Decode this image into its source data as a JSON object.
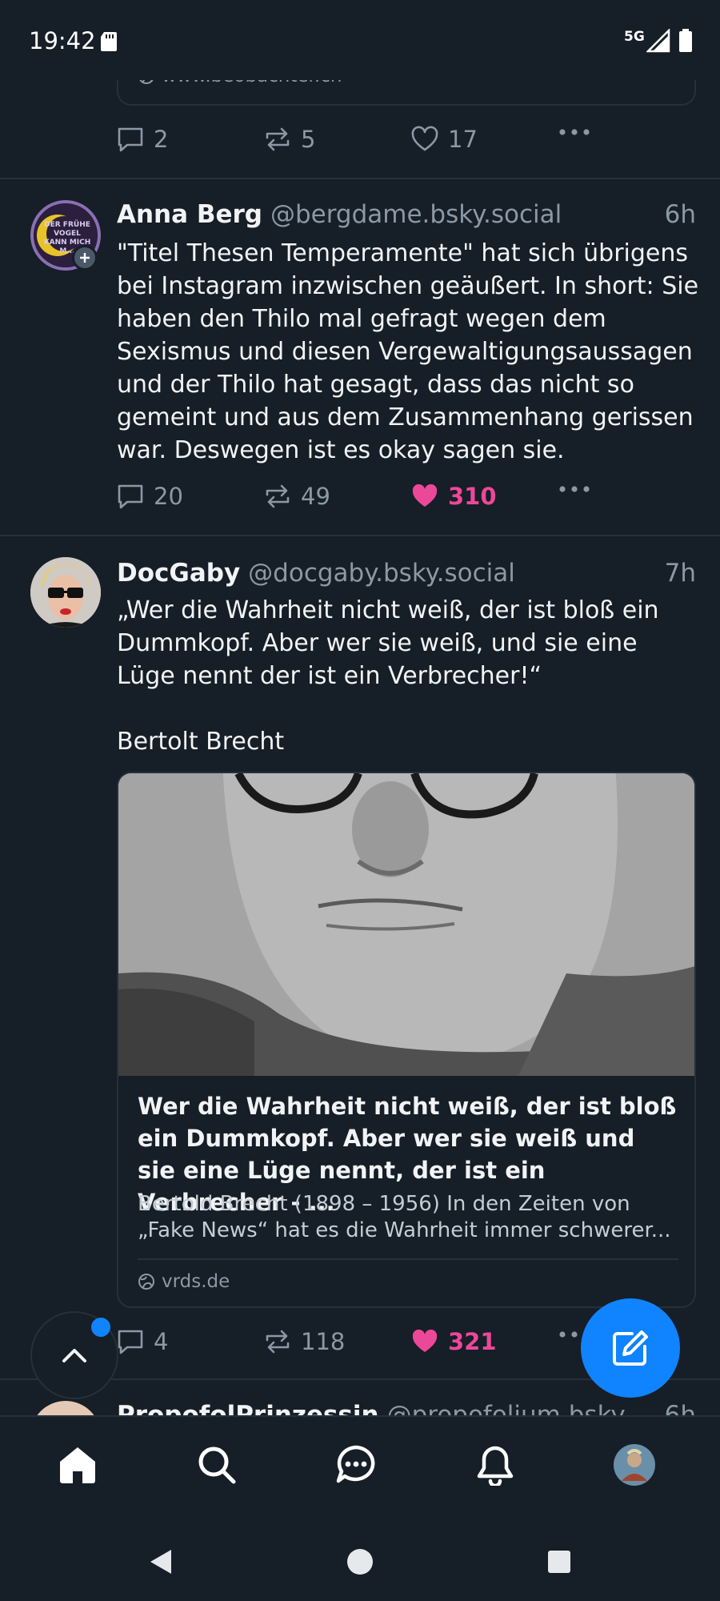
{
  "status_bar": {
    "time": "19:42",
    "network": "5G"
  },
  "top_post": {
    "link_domain": "www.beobachter.ch",
    "replies": "2",
    "reposts": "5",
    "likes": "17"
  },
  "post_anna": {
    "avatar_text": "DER FRÜHE VOGEL KANN MICH M...",
    "name": "Anna Berg",
    "handle": "@bergdame.bsky.social",
    "time": "6h",
    "text": "\"Titel Thesen Temperamente\" hat sich übrigens bei Instagram inzwischen geäußert. In short: Sie haben den Thilo mal gefragt wegen dem Sexismus und diesen Vergewaltigungsaussagen und der Thilo hat gesagt, dass das nicht so gemeint und aus dem Zusammenhang gerissen war. Deswegen ist es okay sagen sie.",
    "replies": "20",
    "reposts": "49",
    "likes": "310",
    "liked": true
  },
  "post_gaby": {
    "name": "DocGaby",
    "handle": "@docgaby.bsky.social",
    "time": "7h",
    "text": "„Wer die Wahrheit nicht weiß, der ist bloß ein Dummkopf. Aber wer sie weiß, und sie eine Lüge nennt der ist ein Verbrecher!“\n\nBertolt Brecht",
    "embed": {
      "title": "Wer die Wahrheit nicht weiß, der ist bloß ein Dummkopf. Aber wer sie weiß und sie eine Lüge nennt, der ist ein Verbrecher - ...",
      "description": "Bertold Brecht (1898 – 1956) In den Zeiten von „Fake News“ hat es die Wahrheit immer schwerer...",
      "domain": "vrds.de"
    },
    "replies": "4",
    "reposts": "118",
    "likes": "321",
    "liked": true
  },
  "next_post": {
    "name": "PropofolPrinzessin",
    "handle": "@propofolium.bsky.so...",
    "time": "6h"
  },
  "tabs": [
    "home-tab",
    "search-tab",
    "chat-tab",
    "notifications-tab",
    "profile-tab"
  ],
  "colors": {
    "background": "#161e27",
    "accent": "#1083fe",
    "like": "#ec4899",
    "muted": "#8b98a5"
  }
}
